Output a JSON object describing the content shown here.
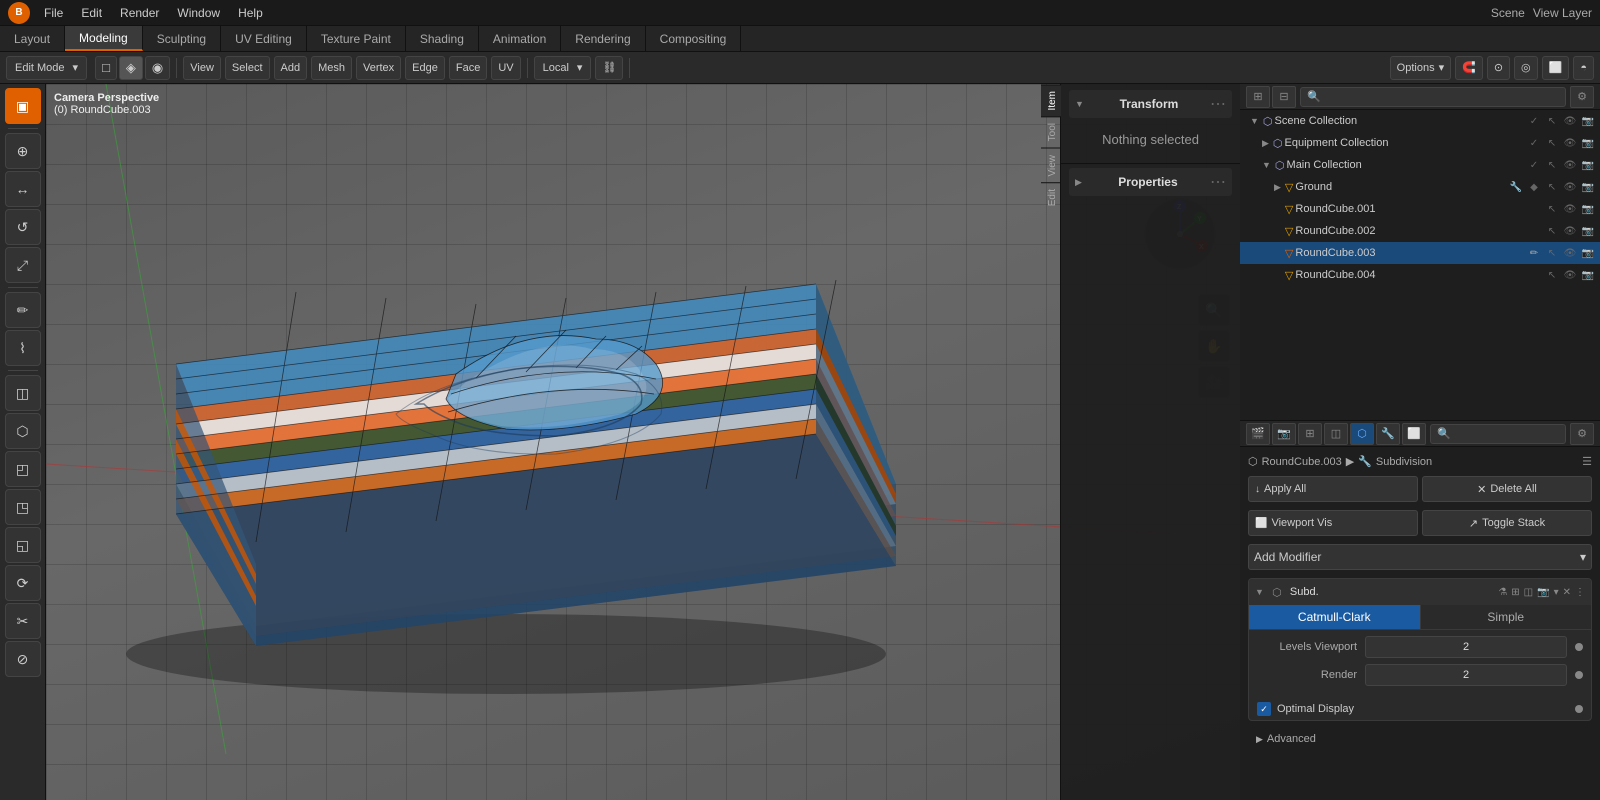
{
  "app": {
    "logo": "B"
  },
  "top_menu": {
    "items": [
      "File",
      "Edit",
      "Render",
      "Window",
      "Help"
    ]
  },
  "workspace_tabs": {
    "tabs": [
      "Layout",
      "Modeling",
      "Sculpting",
      "UV Editing",
      "Texture Paint",
      "Shading",
      "Animation",
      "Rendering",
      "Compositing"
    ],
    "active": "Modeling",
    "scene_label": "Scene",
    "view_layer_label": "View Layer"
  },
  "toolbar": {
    "mode_label": "Edit Mode",
    "view_label": "View",
    "select_label": "Select",
    "add_label": "Add",
    "mesh_label": "Mesh",
    "vertex_label": "Vertex",
    "edge_label": "Edge",
    "face_label": "Face",
    "uv_label": "UV",
    "transform_label": "Local",
    "options_label": "Options"
  },
  "viewport": {
    "label1": "Camera Perspective",
    "label2": "(0) RoundCube.003"
  },
  "left_tools": {
    "tools": [
      "▣",
      "↔",
      "↺",
      "⤢",
      "✏",
      "⌇",
      "⊕",
      "◫",
      "⬡",
      "◰",
      "◳",
      "◱"
    ]
  },
  "right_side_tabs": [
    "Item",
    "Tool",
    "View",
    "Edit"
  ],
  "transform_panel": {
    "title": "Transform",
    "nothing_selected": "Nothing selected"
  },
  "properties_panel": {
    "title": "Properties"
  },
  "outliner": {
    "scene_collection": "Scene Collection",
    "items": [
      {
        "name": "Scene Collection",
        "type": "scene",
        "indent": 0,
        "expanded": true
      },
      {
        "name": "Equipment Collection",
        "type": "collection",
        "indent": 1,
        "expanded": false
      },
      {
        "name": "Main Collection",
        "type": "collection",
        "indent": 1,
        "expanded": true,
        "selected": false
      },
      {
        "name": "Ground",
        "type": "mesh",
        "indent": 2,
        "expanded": false
      },
      {
        "name": "RoundCube.001",
        "type": "mesh",
        "indent": 2,
        "expanded": false
      },
      {
        "name": "RoundCube.002",
        "type": "mesh",
        "indent": 2,
        "expanded": false
      },
      {
        "name": "RoundCube.003",
        "type": "mesh",
        "indent": 2,
        "expanded": false,
        "selected": true
      },
      {
        "name": "RoundCube.004",
        "type": "mesh",
        "indent": 2,
        "expanded": false
      }
    ]
  },
  "modifier_section": {
    "object_name": "RoundCube.003",
    "modifier_type": "Subdivision",
    "apply_all_label": "Apply All",
    "delete_all_label": "Delete All",
    "viewport_vis_label": "Viewport Vis",
    "toggle_stack_label": "Toggle Stack",
    "add_modifier_label": "Add Modifier",
    "modifier_card": {
      "short_name": "Subd.",
      "subdivision_types": [
        "Catmull-Clark",
        "Simple"
      ],
      "active_type": "Catmull-Clark",
      "levels_viewport_label": "Levels Viewport",
      "levels_viewport_value": "2",
      "render_label": "Render",
      "render_value": "2",
      "optimal_display_label": "Optimal Display",
      "optimal_display_checked": true,
      "advanced_label": "Advanced"
    }
  },
  "icons": {
    "chevron_right": "▶",
    "chevron_down": "▼",
    "close": "✕",
    "dots": "⋮",
    "wrench": "🔧",
    "eye": "👁",
    "camera": "📷",
    "render": "🎨",
    "check": "✓",
    "arrow_down": "↓",
    "link_arrow": "↗",
    "filter": "⚙"
  }
}
